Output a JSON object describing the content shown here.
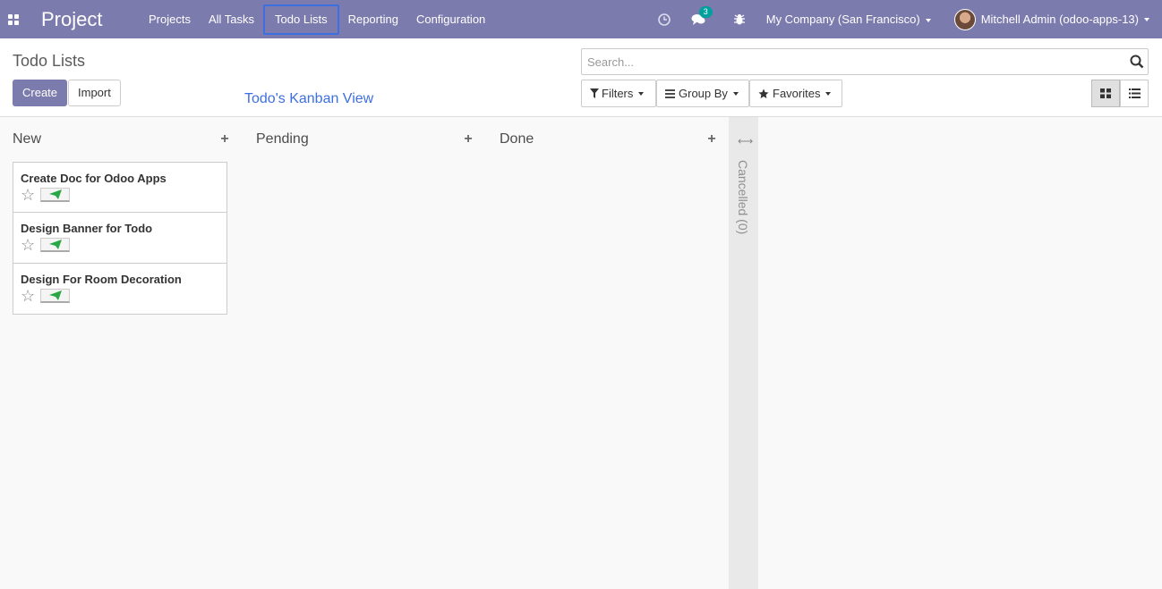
{
  "navbar": {
    "brand": "Project",
    "menu": [
      "Projects",
      "All Tasks",
      "Todo Lists",
      "Reporting",
      "Configuration"
    ],
    "active_menu": "Todo Lists",
    "message_count": "3",
    "company": "My Company (San Francisco)",
    "user": "Mitchell Admin (odoo-apps-13)"
  },
  "control": {
    "title": "Todo Lists",
    "create_label": "Create",
    "import_label": "Import",
    "annotation": "Todo's Kanban View",
    "search_placeholder": "Search...",
    "filters_label": "Filters",
    "groupby_label": "Group By",
    "favorites_label": "Favorites"
  },
  "kanban": {
    "columns": [
      {
        "title": "New",
        "cards": [
          "Create Doc for Odoo Apps",
          "Design Banner for Todo",
          "Design For Room Decoration"
        ]
      },
      {
        "title": "Pending",
        "cards": []
      },
      {
        "title": "Done",
        "cards": []
      }
    ],
    "folded_column": "Cancelled (0)"
  },
  "colors": {
    "navbar": "#7c7bad",
    "primary": "#7c7bad",
    "annotation": "#3d6fe0",
    "send_icon": "#28a745"
  },
  "icons": [
    "apps-grid-icon",
    "clock-icon",
    "chat-icon",
    "bug-icon",
    "search-icon",
    "filter-icon",
    "list-bars-icon",
    "star-icon",
    "kanban-grid-icon",
    "list-view-icon",
    "send-icon",
    "expand-arrows-icon"
  ]
}
